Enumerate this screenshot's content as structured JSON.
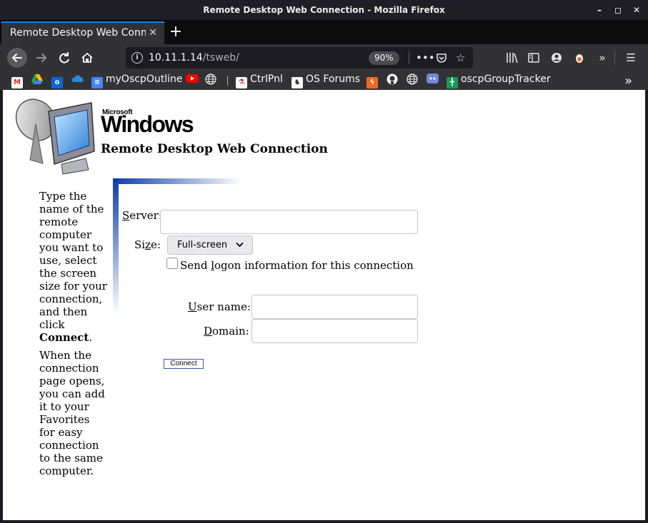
{
  "window": {
    "title": "Remote Desktop Web Connection - Mozilla Firefox",
    "controls": [
      "–",
      "◻",
      "✕"
    ]
  },
  "tabs": [
    {
      "label": "Remote Desktop Web Conne",
      "close": "✕"
    }
  ],
  "toolbar": {
    "new_tab": "+",
    "url_host": "10.11.1.14",
    "url_path": "/tsweb/",
    "zoom": "90%"
  },
  "bookmarks": [
    {
      "label": "",
      "icon": "gmail-icon",
      "color": "#d93025"
    },
    {
      "label": "",
      "icon": "google-drive-icon",
      "color": "#1fa463"
    },
    {
      "label": "",
      "icon": "outlook-icon",
      "color": "#0a64d6"
    },
    {
      "label": "",
      "icon": "onedrive-icon",
      "color": "#2b88d8"
    },
    {
      "label": "myOscpOutline",
      "icon": "google-docs-icon",
      "color": "#4285f4"
    },
    {
      "label": "",
      "icon": "youtube-icon",
      "color": "#ff0000"
    },
    {
      "label": "",
      "icon": "globe-icon",
      "color": "#5a5a5e"
    },
    {
      "label": "CtrlPnl",
      "icon": "ctrlpnl-icon",
      "color": "#b82020"
    },
    {
      "label": "OS Forums",
      "icon": "os-forums-icon",
      "color": "#2a2a2e"
    },
    {
      "label": "",
      "icon": "lightning-icon",
      "color": "#f26a21"
    },
    {
      "label": "",
      "icon": "github-icon",
      "color": "#f9f9fa"
    },
    {
      "label": "",
      "icon": "globe-icon",
      "color": "#5a5a5e"
    },
    {
      "label": "",
      "icon": "discord-icon",
      "color": "#7289da"
    },
    {
      "label": "oscpGroupTracker",
      "icon": "google-sheets-icon",
      "color": "#0f9d58"
    }
  ],
  "page": {
    "microsoft": "Microsoft",
    "windows": "Windows",
    "title": "Remote Desktop Web Connection",
    "help_p1_a": "Type the name of the remote computer you want to use, select the screen size for your connection, and then click ",
    "help_p1_b": "Connect",
    "help_p1_c": ".",
    "help_p2": "When the connection page opens, you can add it to your Favorites for easy connection to the same computer.",
    "server_label_u": "S",
    "server_label_rest": "erver:",
    "server_value": "",
    "size_label_a": "Si",
    "size_label_u": "z",
    "size_label_c": "e:",
    "size_value": "Full-screen",
    "send_logon_a": "Send ",
    "send_logon_u": "l",
    "send_logon_b": "ogon information for this connection",
    "username_label_u": "U",
    "username_label_rest": "ser name:",
    "username_value": "",
    "domain_label_u": "D",
    "domain_label_rest": "omain:",
    "domain_value": "",
    "connect_button": "Connect"
  }
}
